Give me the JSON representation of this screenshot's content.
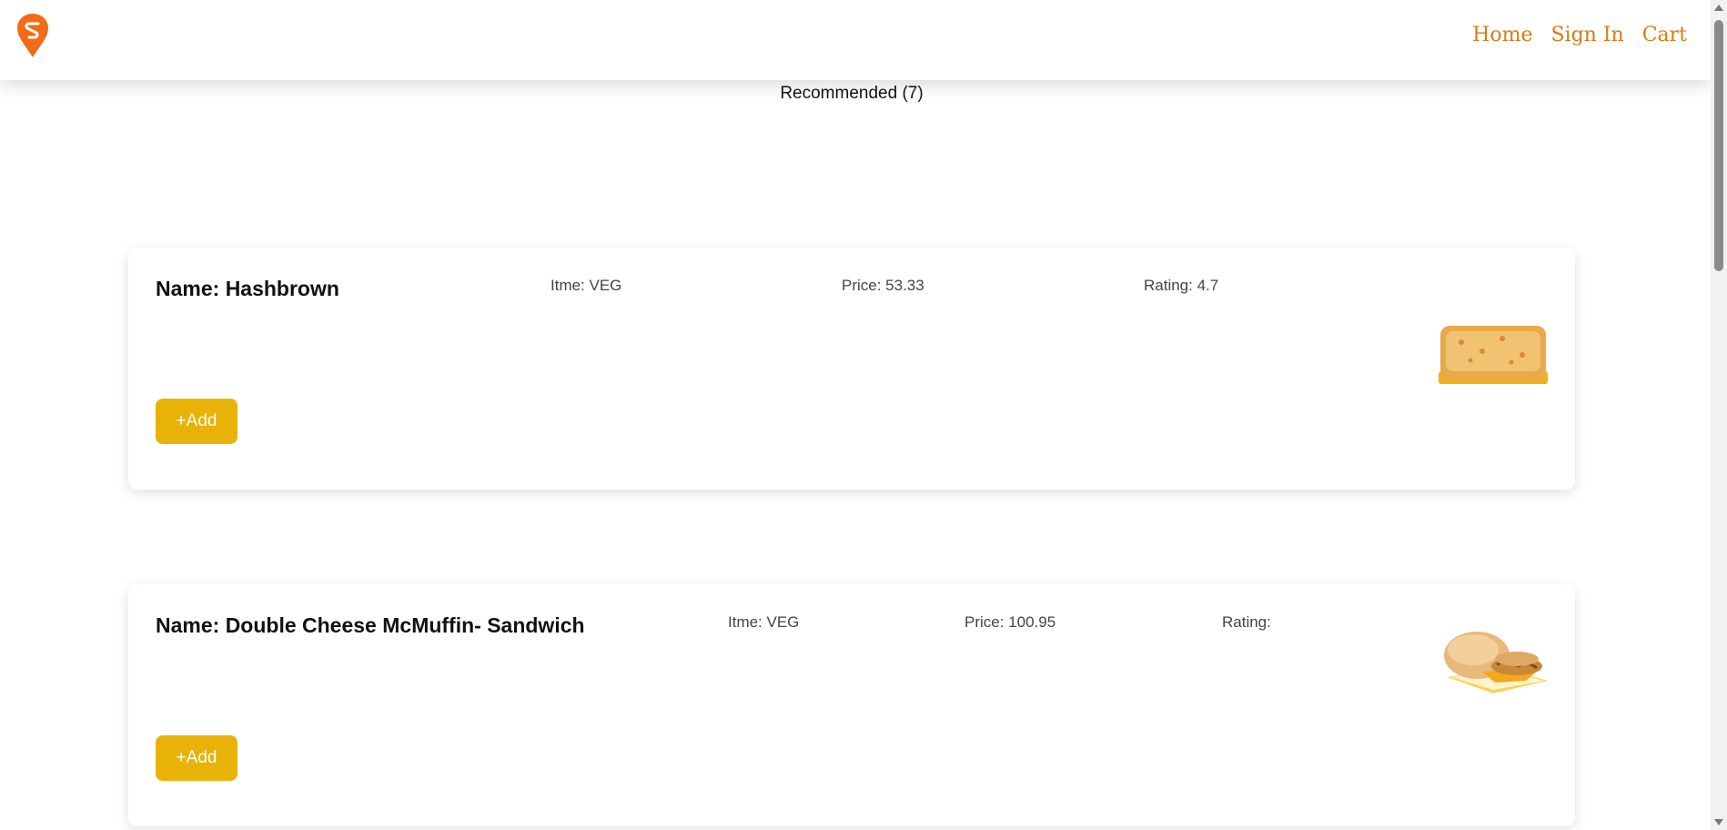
{
  "header": {
    "logo_icon": "swiggy-logo-icon",
    "nav": {
      "home": "Home",
      "sign_in": "Sign In",
      "cart": "Cart"
    },
    "nav_color": "#d97b16"
  },
  "section": {
    "title": "Recommended (7)"
  },
  "items": [
    {
      "name": "Name: Hashbrown",
      "type": "Itme: VEG",
      "price": "Price: 53.33",
      "rating": "Rating: 4.7",
      "add_label": "+Add",
      "image_icon": "hashbrown-image"
    },
    {
      "name": "Name: Double Cheese McMuffin- Sandwich",
      "type": "Itme: VEG",
      "price": "Price: 100.95",
      "rating": "Rating:",
      "add_label": "+Add",
      "image_icon": "sandwich-image"
    }
  ],
  "colors": {
    "add_button": "#e8b208",
    "logo": "#f26b16"
  }
}
